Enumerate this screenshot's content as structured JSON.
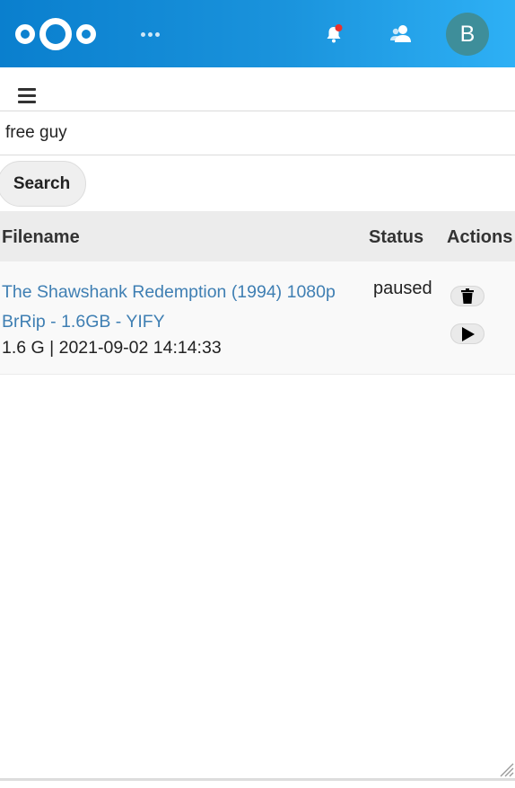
{
  "header": {
    "logo_icon": "nextcloud-logo",
    "apps_icon": "more-apps-icon",
    "notifications_icon": "bell-icon",
    "notification_dot_color": "#e9322d",
    "contacts_icon": "contacts-icon",
    "avatar_letter": "B",
    "avatar_color": "#3e8e9a"
  },
  "nav": {
    "menu_icon": "hamburger-menu-icon"
  },
  "search": {
    "value": "free guy",
    "button_label": "Search"
  },
  "table": {
    "columns": [
      "Filename",
      "Status",
      "Actions"
    ],
    "rows": [
      {
        "filename": "The Shawshank Redemption (1994) 1080p BrRip - 1.6GB - YIFY",
        "meta": "1.6 G | 2021-09-02 14:14:33",
        "status": "paused",
        "actions": [
          "trash-icon",
          "play-icon"
        ]
      }
    ]
  }
}
